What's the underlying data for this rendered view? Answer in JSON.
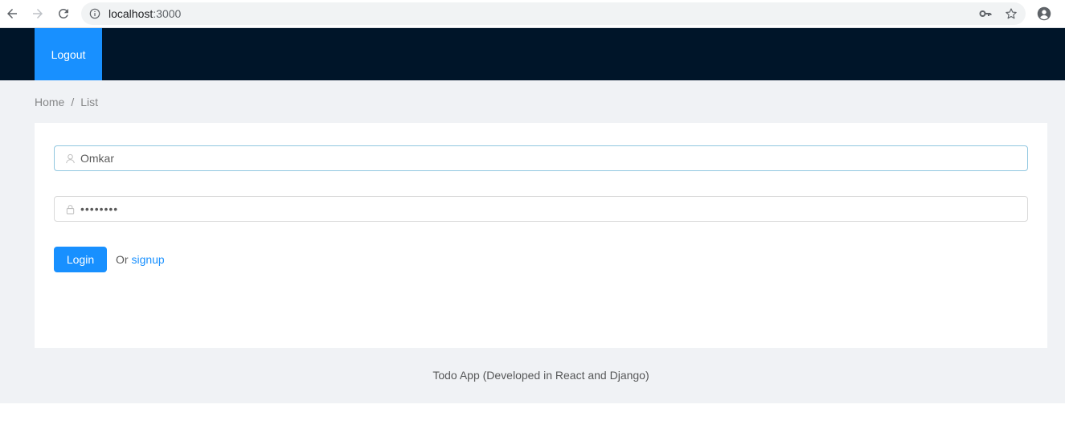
{
  "browser": {
    "url_host": "localhost",
    "url_port": ":3000",
    "icons": [
      "back-arrow-icon",
      "forward-arrow-icon",
      "reload-icon",
      "info-icon",
      "key-icon",
      "star-icon",
      "account-icon"
    ]
  },
  "header": {
    "logout_label": "Logout",
    "background_color": "#001529",
    "accent_color": "#1890ff"
  },
  "breadcrumb": {
    "items": [
      "Home",
      "List"
    ],
    "separator": "/"
  },
  "login_form": {
    "username_value": "Omkar",
    "username_icon": "user-icon",
    "password_value": "••••••••",
    "password_icon": "lock-icon",
    "login_label": "Login",
    "or_text": "Or",
    "signup_label": "signup"
  },
  "footer": {
    "text": "Todo App (Developed in React and Django)"
  }
}
